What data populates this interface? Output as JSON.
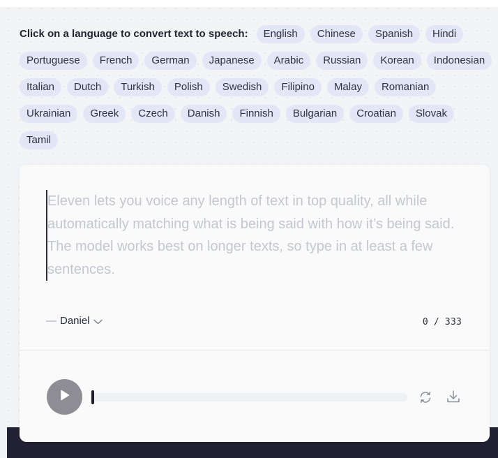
{
  "languages": {
    "prompt": "Click on a language to convert text to speech:",
    "items": [
      "English",
      "Chinese",
      "Spanish",
      "Hindi",
      "Portuguese",
      "French",
      "German",
      "Japanese",
      "Arabic",
      "Russian",
      "Korean",
      "Indonesian",
      "Italian",
      "Dutch",
      "Turkish",
      "Polish",
      "Swedish",
      "Filipino",
      "Malay",
      "Romanian",
      "Ukrainian",
      "Greek",
      "Czech",
      "Danish",
      "Finnish",
      "Bulgarian",
      "Croatian",
      "Slovak",
      "Tamil"
    ]
  },
  "editor": {
    "placeholder": "Eleven lets you voice any length of text in top quality, all while automatically matching what is being said with how it’s being said. The model works best on longer texts, so type in at least a few sentences.",
    "value": ""
  },
  "voice": {
    "dash": "—",
    "selected": "Daniel",
    "dropdown_icon": "chevron-down-icon"
  },
  "counter": {
    "text": "0 / 333"
  },
  "player": {
    "play_icon": "play-icon",
    "regenerate_icon": "refresh-icon",
    "download_icon": "download-icon",
    "progress": 0
  },
  "colors": {
    "chip_bg": "#e3e6f7",
    "play_bg": "#8d8d93",
    "footer_bg": "#232234"
  }
}
